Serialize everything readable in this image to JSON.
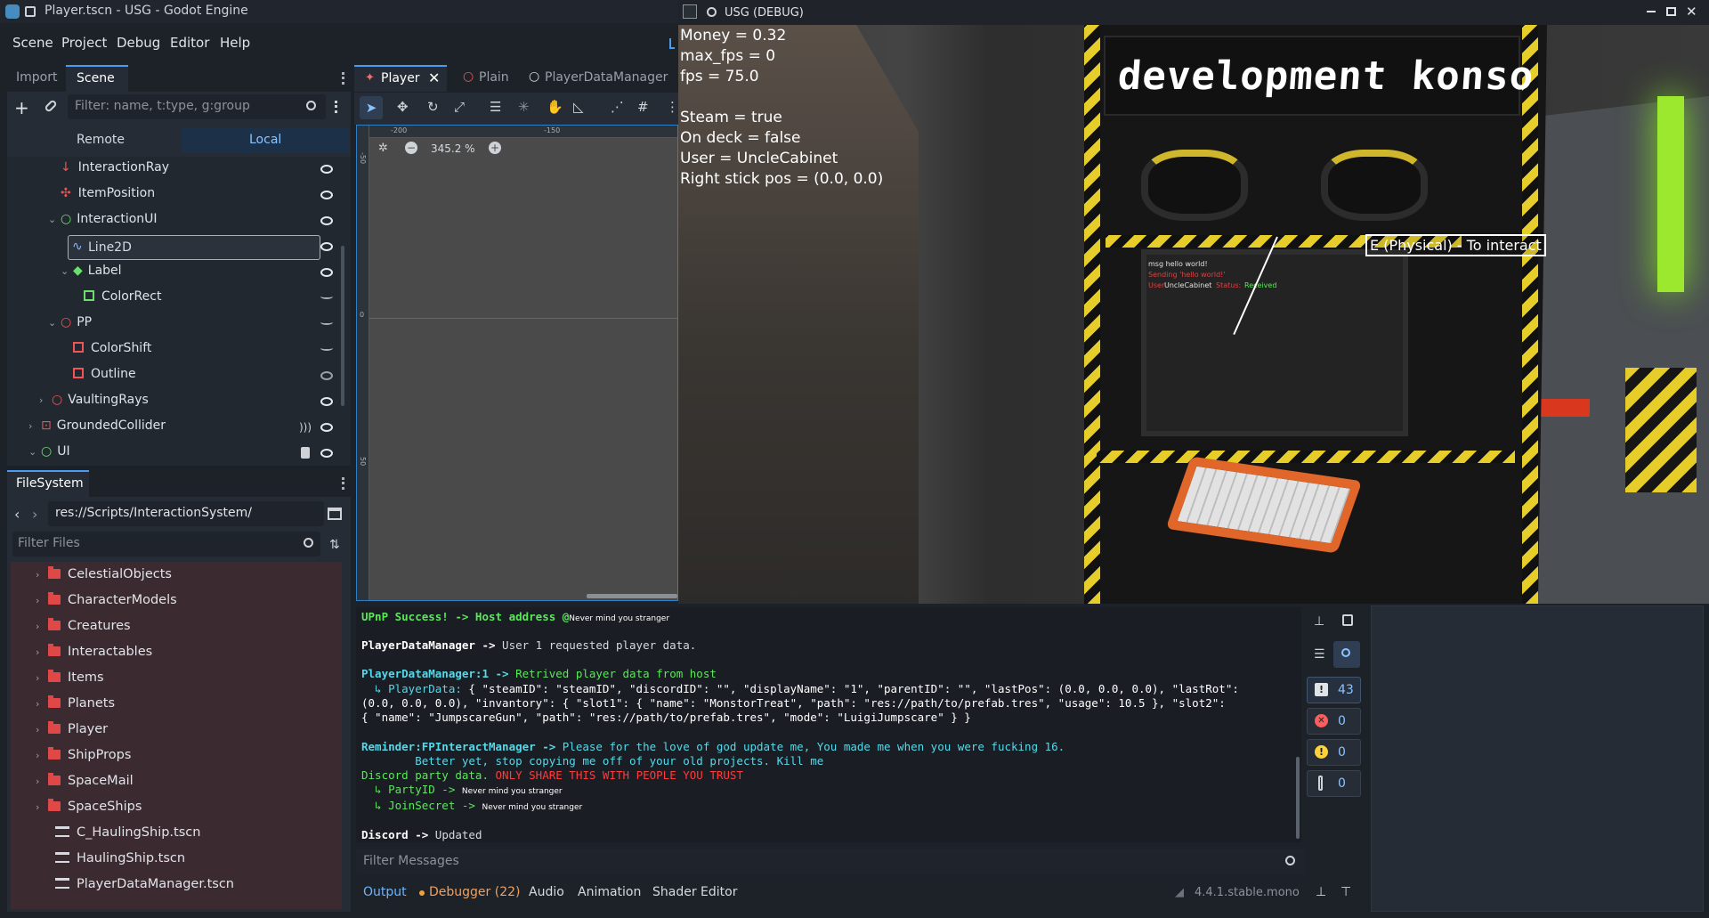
{
  "window": {
    "title": "Player.tscn - USG - Godot Engine"
  },
  "menu": [
    "Scene",
    "Project",
    "Debug",
    "Editor",
    "Help"
  ],
  "scene_dock": {
    "tabs": [
      "Import",
      "Scene"
    ],
    "filter_placeholder": "Filter: name, t:type, g:group",
    "remote": "Remote",
    "local": "Local",
    "nodes": [
      {
        "label": "InteractionRay"
      },
      {
        "label": "ItemPosition"
      },
      {
        "label": "InteractionUI"
      },
      {
        "label": "Line2D"
      },
      {
        "label": "Label"
      },
      {
        "label": "ColorRect"
      },
      {
        "label": "PP"
      },
      {
        "label": "ColorShift"
      },
      {
        "label": "Outline"
      },
      {
        "label": "VaultingRays"
      },
      {
        "label": "GroundedCollider"
      },
      {
        "label": "UI"
      }
    ]
  },
  "filesystem": {
    "tab": "FileSystem",
    "path": "res://Scripts/InteractionSystem/",
    "filter_placeholder": "Filter Files",
    "folders": [
      "CelestialObjects",
      "CharacterModels",
      "Creatures",
      "Interactables",
      "Items",
      "Planets",
      "Player",
      "ShipProps",
      "SpaceMail",
      "SpaceShips"
    ],
    "files": [
      "C_HaulingShip.tscn",
      "HaulingShip.tscn",
      "PlayerDataManager.tscn"
    ]
  },
  "scene_tabs": [
    "Player",
    "Plain",
    "PlayerDataManager"
  ],
  "viewport": {
    "zoom": "345.2 %",
    "ruler_top": [
      "-200",
      "-150"
    ],
    "ruler_left": [
      "-50",
      "0",
      "50"
    ]
  },
  "game": {
    "title": "USG (DEBUG)",
    "hud": [
      "Money = 0.32",
      "max_fps = 0",
      "fps = 75.0",
      "Steam = true",
      "On deck = false",
      "User = UncleCabinet",
      "Right stick pos = (0.0, 0.0)"
    ],
    "sign": "development konso",
    "interact_prompt": "E (Physical) - To interact",
    "chat": {
      "line1": "msg hello world!",
      "line2": "Sending 'hello world!'",
      "user_label": "User",
      "user_name": "UncleCabinet",
      "status_label": "Status:",
      "status_value": "Received"
    }
  },
  "console": {
    "l1a": "UPnP Success! -> Host address @",
    "l1b": "Never mind you stranger",
    "l2a": "PlayerDataManager ->",
    "l2b": " User 1 requested player data.",
    "l3a": "PlayerDataManager:1 ->",
    "l3b": " Retrived player data from host",
    "l4a": "  ↳ PlayerData:",
    "l4b": " { \"steamID\": \"steamID\", \"discordID\": \"\", \"displayName\": \"1\", \"parentID\": \"\", \"lastPos\": (0.0, 0.0, 0.0), \"lastRot\":",
    "l5": "(0.0, 0.0, 0.0), \"invantory\": { \"slot1\": { \"name\": \"MonstorTreat\", \"path\": \"res://path/to/prefab.tres\", \"usage\": 10.5 }, \"slot2\":",
    "l6": "{ \"name\": \"JumpscareGun\", \"path\": \"res://path/to/prefab.tres\", \"mode\": \"LuigiJumpscare\" } }",
    "l7a": "Reminder:FPInteractManager ->",
    "l7b": " Please for the love of god update me, You made me when you were fucking 16.",
    "l8": "        Better yet, stop copying me off of your old projects. Kill me",
    "l9a": "Discord party data.",
    "l9b": " ONLY SHARE THIS WITH PEOPLE YOU TRUST",
    "l10a": "  ↳ PartyID ->",
    "l10b": "Never mind you stranger",
    "l11a": "  ↳ JoinSecret ->",
    "l11b": "Never mind you stranger",
    "l12a": "Discord ->",
    "l12b": " Updated",
    "filter_placeholder": "Filter Messages",
    "counts": {
      "all": "43",
      "errors": "0",
      "warnings": "0",
      "info": "0"
    }
  },
  "bottom_tabs": [
    "Output",
    "Debugger (22)",
    "Audio",
    "Animation",
    "Shader Editor"
  ],
  "version": "4.4.1.stable.mono",
  "colors": {
    "accent": "#4a9cf0",
    "console_green": "#5ce65c",
    "console_red": "#ff3a3a",
    "console_cyan": "#56d8e8"
  }
}
